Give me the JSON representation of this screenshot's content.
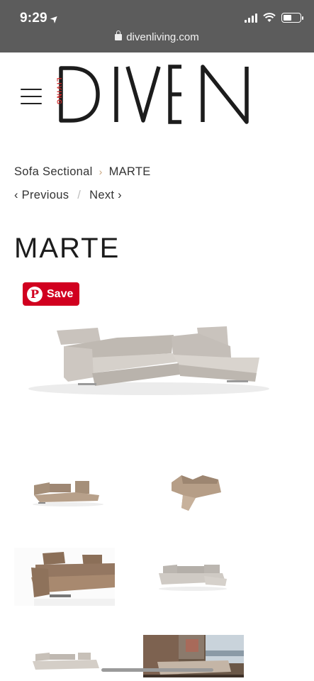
{
  "status_bar": {
    "time": "9:29",
    "location_icon": "location-arrow-icon",
    "signal_icon": "cellular-signal-icon",
    "wifi_icon": "wifi-icon",
    "battery_icon": "battery-icon",
    "battery_level": 0.5
  },
  "browser": {
    "url": "divenliving.com",
    "lock_icon": "lock-icon"
  },
  "header": {
    "menu_icon": "hamburger-menu-icon",
    "logo_main": "DIVEN",
    "logo_sub": "LIVING",
    "logo_sub_color": "#d42a2a"
  },
  "breadcrumb": {
    "parent": "Sofa Sectional",
    "separator": "›",
    "current": "MARTE"
  },
  "pager": {
    "previous": "‹ Previous",
    "divider": "/",
    "next": "Next ›"
  },
  "product": {
    "title": "MARTE"
  },
  "pinterest": {
    "label": "Save",
    "glyph": "P",
    "color": "#d1001f"
  },
  "images": {
    "main": "sofa-sectional-main-image",
    "thumbnails": [
      "sofa-thumbnail-angle-view",
      "sofa-thumbnail-top-view",
      "sofa-thumbnail-closeup-recliner",
      "sofa-thumbnail-grey-front",
      "sofa-thumbnail-bottom-left",
      "sofa-thumbnail-room-scene"
    ]
  }
}
